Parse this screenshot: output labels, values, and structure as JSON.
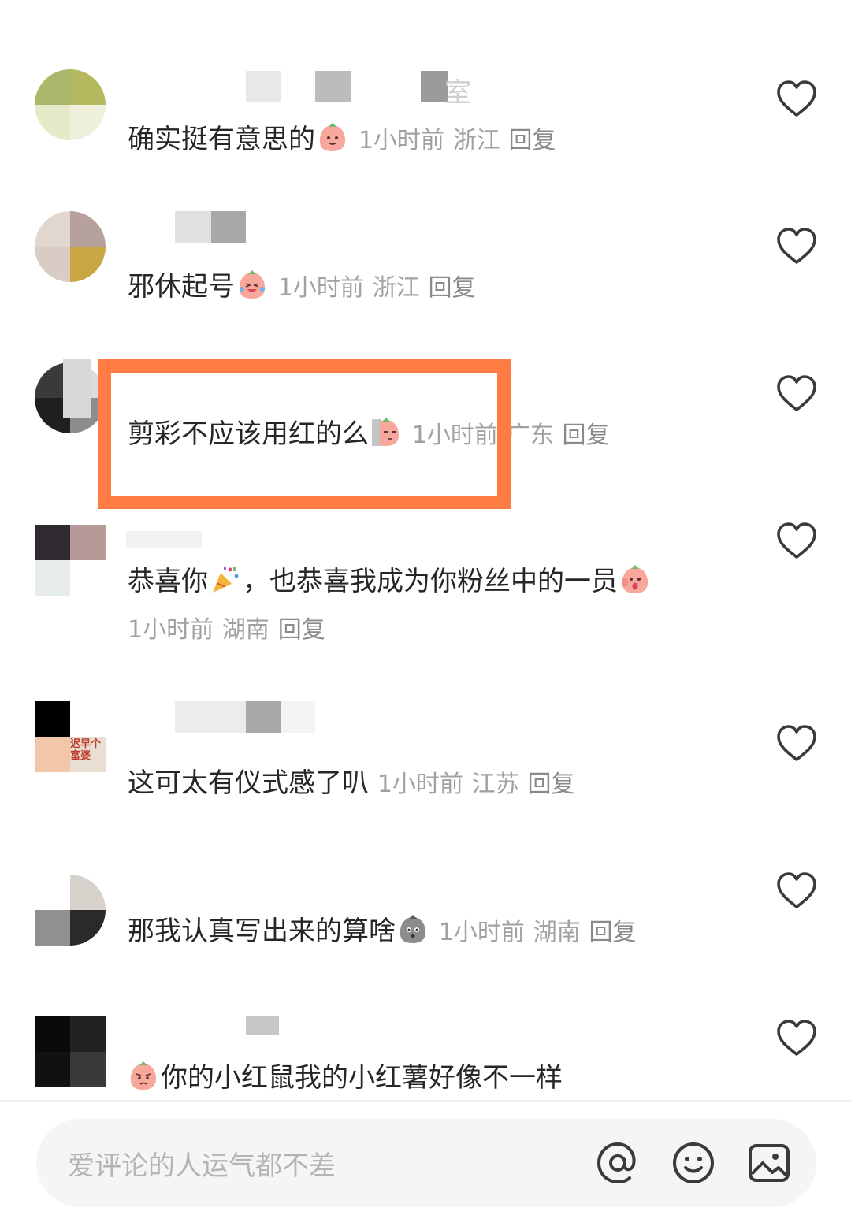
{
  "comments": [
    {
      "text": "确实挺有意思的",
      "emoji": "happy-sweet-potato-emoji",
      "time": "1小时前",
      "location": "浙江",
      "reply": "回复",
      "name_partial": "室"
    },
    {
      "text": "邪休起号",
      "emoji": "crying-laughing-sweet-potato-emoji",
      "time": "1小时前",
      "location": "浙江",
      "reply": "回复"
    },
    {
      "text": "剪彩不应该用红的么",
      "emoji": "peeking-sweet-potato-emoji",
      "time": "1小时前",
      "location": "广东",
      "reply": "回复"
    },
    {
      "text_a": "恭喜你",
      "text_b": "，也恭喜我成为你粉丝中的一员",
      "emoji_a": "party-popper-emoji",
      "emoji_b": "shocked-sweet-potato-emoji",
      "time": "1小时前",
      "location": "湖南",
      "reply": "回复"
    },
    {
      "text": "这可太有仪式感了叭",
      "time": "1小时前",
      "location": "江苏",
      "reply": "回复",
      "avatar_text": "迟早个富婆"
    },
    {
      "text": "那我认真写出来的算啥",
      "emoji": "gray-sweet-potato-emoji",
      "time": "1小时前",
      "location": "湖南",
      "reply": "回复"
    },
    {
      "text": "你的小红鼠我的小红薯好像不一样",
      "emoji": "pleading-sweet-potato-emoji"
    }
  ],
  "input": {
    "placeholder": "爱评论的人运气都不差"
  },
  "icons": {
    "mention": "at-icon",
    "emoji": "smiley-icon",
    "image": "image-icon",
    "like": "heart-icon"
  },
  "colors": {
    "highlight": "#ff7c45",
    "meta": "#a1a1a1",
    "text": "#262626"
  }
}
